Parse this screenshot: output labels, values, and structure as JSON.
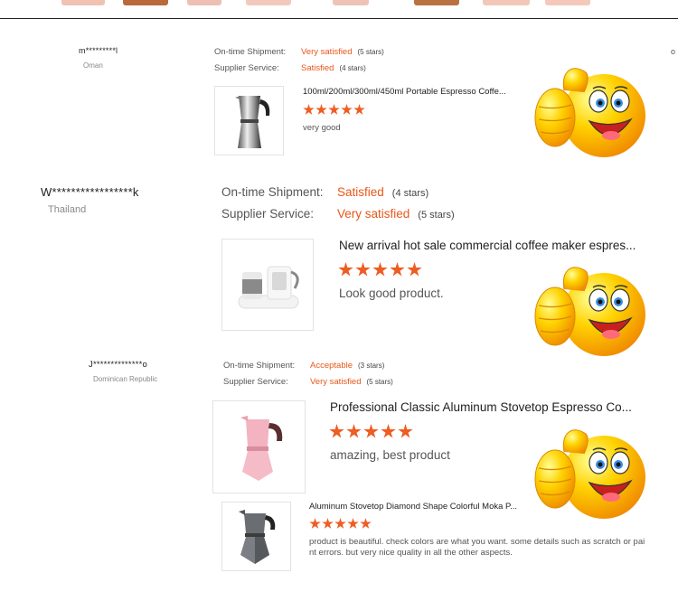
{
  "reviews": [
    {
      "buyer": "m*********l",
      "country": "Oman",
      "shipment_label": "On-time Shipment:",
      "shipment_value": "Very satisfied",
      "shipment_stars": "(5 stars)",
      "service_label": "Supplier Service:",
      "service_value": "Satisfied",
      "service_stars": "(4 stars)",
      "products": [
        {
          "title": "100ml/200ml/300ml/450ml Portable Espresso Coffe...",
          "rating": 5,
          "comment": "very good"
        }
      ]
    },
    {
      "buyer": "W*****************k",
      "country": "Thailand",
      "shipment_label": "On-time Shipment:",
      "shipment_value": "Satisfied",
      "shipment_stars": "(4 stars)",
      "service_label": "Supplier Service:",
      "service_value": "Very satisfied",
      "service_stars": "(5 stars)",
      "products": [
        {
          "title": "New arrival hot sale commercial coffee maker espres...",
          "rating": 5,
          "comment": "Look good product."
        }
      ]
    },
    {
      "buyer": "J**************o",
      "country": "Dominican Republic",
      "shipment_label": "On-time Shipment:",
      "shipment_value": "Acceptable",
      "shipment_stars": "(3 stars)",
      "service_label": "Supplier Service:",
      "service_value": "Very satisfied",
      "service_stars": "(5 stars)",
      "products": [
        {
          "title": "Professional Classic Aluminum Stovetop Espresso Co...",
          "rating": 5,
          "comment": "amazing, best product"
        },
        {
          "title": "Aluminum Stovetop Diamond Shape Colorful Moka P...",
          "rating": 5,
          "comment": "product is beautiful. check colors are what you want. some details such as scratch or paint errors. but very nice quality in all the other aspects."
        }
      ]
    }
  ],
  "edge_char": "o",
  "colors": {
    "accent": "#e8571a",
    "star": "#ee5d22",
    "divider": "#222222"
  }
}
